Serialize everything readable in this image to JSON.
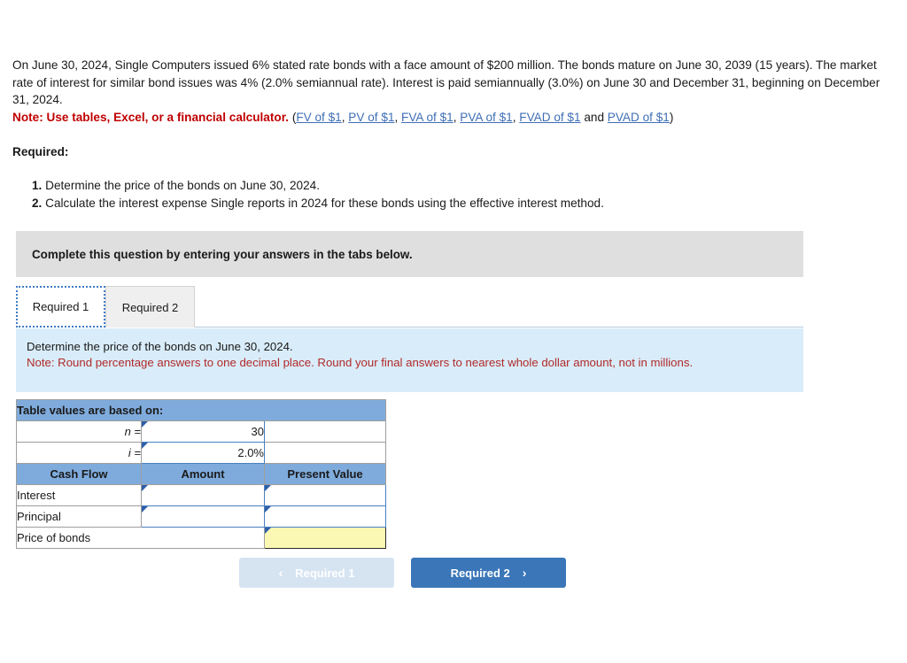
{
  "problem": {
    "paragraph": "On June 30, 2024, Single Computers issued 6% stated rate bonds with a face amount of $200 million. The bonds mature on June 30, 2039 (15 years). The market rate of interest for similar bond issues was 4% (2.0% semiannual rate). Interest is paid semiannually (3.0%) on June 30 and December 31, beginning on December 31, 2024.",
    "note_bold": "Note: Use tables, Excel, or a financial calculator.",
    "links_open_paren": "(",
    "links": [
      "FV of $1",
      "PV of $1",
      "FVA of $1",
      "PVA of $1",
      "FVAD of $1",
      "PVAD of $1"
    ],
    "links_sep": ", ",
    "links_and": " and ",
    "links_close_paren": ")"
  },
  "required": {
    "heading": "Required:",
    "items": [
      {
        "num": "1.",
        "text": "Determine the price of the bonds on June 30, 2024."
      },
      {
        "num": "2.",
        "text": "Calculate the interest expense Single reports in 2024 for these bonds using the effective interest method."
      }
    ]
  },
  "banner": {
    "text": "Complete this question by entering your answers in the tabs below."
  },
  "tabs": [
    {
      "label": "Required 1",
      "active": true
    },
    {
      "label": "Required 2",
      "active": false
    }
  ],
  "instructions": {
    "line1": "Determine the price of the bonds on June 30, 2024.",
    "line2": "Note: Round percentage answers to one decimal place. Round your final answers to nearest whole dollar amount, not in millions."
  },
  "table": {
    "caption": "Table values are based on:",
    "params": [
      {
        "label": "n =",
        "value": "30"
      },
      {
        "label": "i =",
        "value": "2.0%"
      }
    ],
    "columns": [
      "Cash Flow",
      "Amount",
      "Present Value"
    ],
    "rows": [
      {
        "label": "Interest",
        "amount": "",
        "present_value": ""
      },
      {
        "label": "Principal",
        "amount": "",
        "present_value": ""
      }
    ],
    "total_row": {
      "label": "Price of bonds",
      "value": ""
    }
  },
  "nav": {
    "prev_label": "Required 1",
    "prev_icon": "chevron-left",
    "prev_glyph": "‹",
    "next_label": "Required 2",
    "next_icon": "chevron-right",
    "next_glyph": "›"
  },
  "colors": {
    "header_blue": "#7fabdc",
    "instr_blue": "#d9ecf9",
    "banner_gray": "#dfdfdf",
    "note_red": "#c00000",
    "instr_red": "#b02a2a",
    "link_blue": "#3f6fb5",
    "btn_active": "#3a76b8",
    "btn_disabled": "#d6e4f2",
    "answer_yellow": "#fbf8b4",
    "input_border": "#4a7fc1"
  }
}
